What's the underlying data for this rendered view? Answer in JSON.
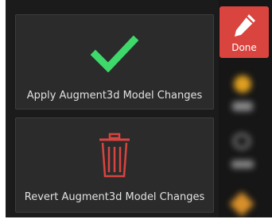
{
  "apply_card": {
    "label": "Apply Augment3d Model Changes",
    "icon": "checkmark-icon",
    "icon_color": "#3fd86a"
  },
  "revert_card": {
    "label": "Revert Augment3d Model Changes",
    "icon": "trash-icon",
    "icon_color": "#d9443f"
  },
  "sidebar": {
    "done_button": {
      "label": "Done",
      "icon": "pencil-icon",
      "background": "#d9443f"
    },
    "blurred_tools": [
      {
        "icon": "yellow-tool-icon",
        "color": "#e0a020"
      },
      {
        "icon": "gray-tool-icon",
        "color": "#8a8a8a"
      },
      {
        "icon": "gray-tool-icon-2",
        "color": "#9a9a9a"
      },
      {
        "icon": "orange-tool-icon",
        "color": "#d9902a"
      }
    ]
  }
}
